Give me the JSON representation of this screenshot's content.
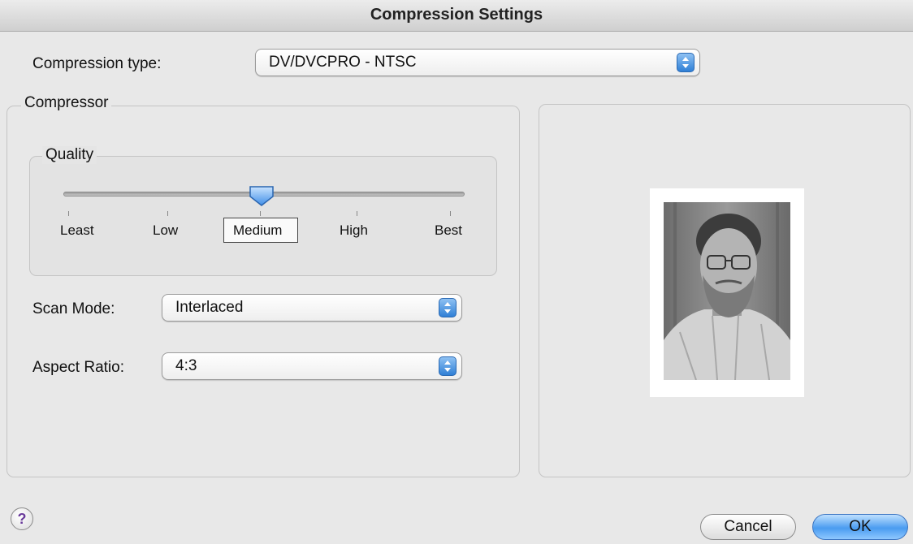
{
  "window": {
    "title": "Compression Settings"
  },
  "compression_type": {
    "label": "Compression type:",
    "value": "DV/DVCPRO - NTSC"
  },
  "compressor": {
    "title": "Compressor",
    "quality": {
      "title": "Quality",
      "ticks": [
        "Least",
        "Low",
        "Medium",
        "High",
        "Best"
      ],
      "selected": "Medium",
      "level_fraction": 0.5
    },
    "scan_mode": {
      "label": "Scan Mode:",
      "value": "Interlaced"
    },
    "aspect_ratio": {
      "label": "Aspect Ratio:",
      "value": "4:3"
    }
  },
  "buttons": {
    "help": "?",
    "cancel": "Cancel",
    "ok": "OK"
  },
  "colors": {
    "accent": "#3b8be0",
    "window_bg": "#e8e8e8"
  }
}
